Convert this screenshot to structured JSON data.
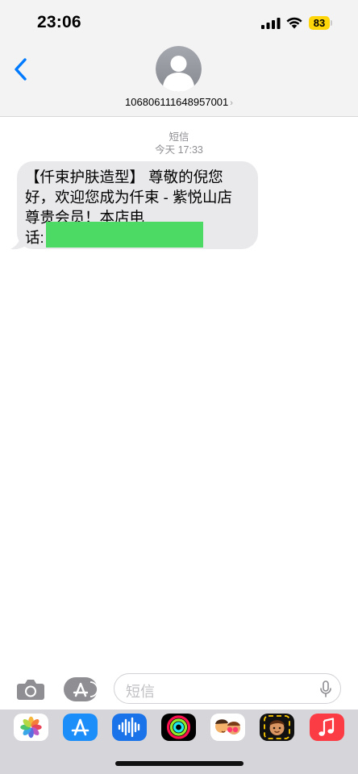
{
  "status_bar": {
    "time": "23:06",
    "battery": "83"
  },
  "header": {
    "back": "back",
    "contact_number": "106806111648957001",
    "chevron": "›"
  },
  "conversation": {
    "type_label": "短信",
    "timestamp": "今天 17:33",
    "message_lines": [
      "【仟束护肤造型】 尊敬的倪您",
      "好，欢迎您成为仟束 - 紫悦山店",
      "尊贵会员！本店电",
      "话:"
    ]
  },
  "input_bar": {
    "placeholder": "短信"
  },
  "app_drawer": {
    "apps": [
      "photos",
      "app-store",
      "audio-message",
      "activity",
      "memoji",
      "memoji-stickers",
      "music"
    ]
  },
  "colors": {
    "accent": "#007aff",
    "bubble": "#e9e9eb",
    "redaction": "#4cd964",
    "battery": "#ffd60a"
  },
  "icons": {
    "back": "chevron-left-icon",
    "camera": "camera-icon",
    "apps": "app-store-icon",
    "mic": "microphone-icon"
  }
}
